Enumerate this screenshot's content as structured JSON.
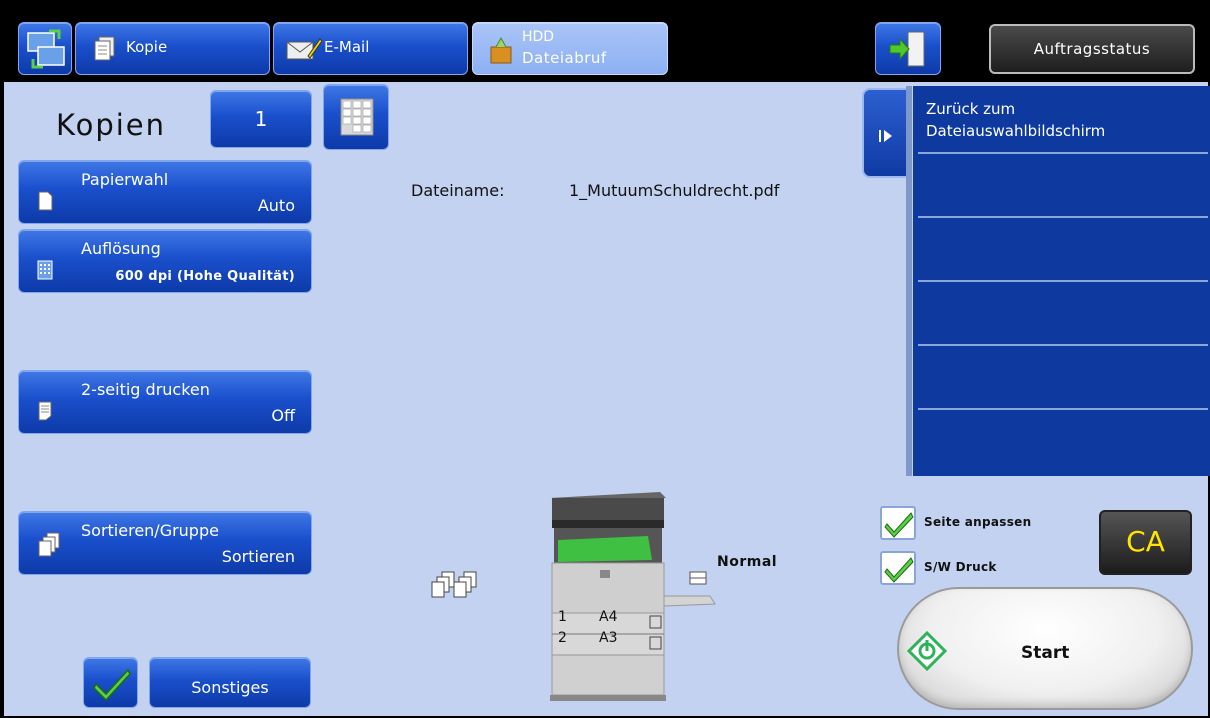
{
  "tabs": [
    {
      "label": "Kopie"
    },
    {
      "label": "E-Mail"
    },
    {
      "line1": "HDD",
      "line2": "Dateiabruf"
    }
  ],
  "job_status_label": "Auftragsstatus",
  "copies": {
    "label": "Kopien",
    "value": "1"
  },
  "functions": {
    "paper": {
      "title": "Papierwahl",
      "value": "Auto"
    },
    "resolution": {
      "title": "Auflösung",
      "value": "600 dpi (Hohe Qualität)"
    },
    "duplex": {
      "title": "2-seitig drucken",
      "value": "Off"
    },
    "sort": {
      "title": "Sortieren/Gruppe",
      "value": "Sortieren"
    }
  },
  "other_label": "Sonstiges",
  "file": {
    "label": "Dateiname:",
    "value": "1_MutuumSchuldrecht.pdf"
  },
  "right_panel": {
    "line1": "Zurück zum",
    "line2": "Dateiauswahlbildschirm"
  },
  "output_label": "Normal",
  "trays": [
    {
      "num": "1",
      "size": "A4"
    },
    {
      "num": "2",
      "size": "A3"
    }
  ],
  "options": {
    "fit_page": "Seite anpassen",
    "bw_print": "S/W Druck"
  },
  "clear_all_label": "CA",
  "start_label": "Start",
  "colors": {
    "accent": "#1a4fcc",
    "panel": "#c3d2f0",
    "list": "#0e3aa0"
  }
}
